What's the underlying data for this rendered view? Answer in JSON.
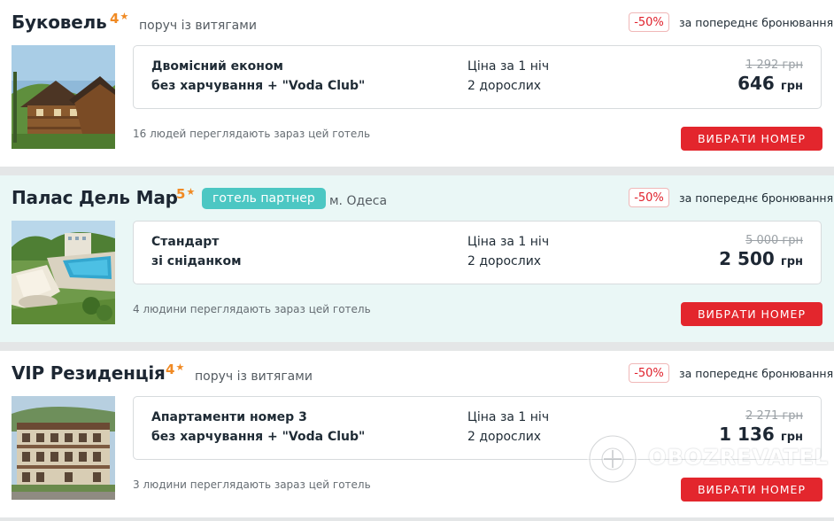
{
  "hotels": [
    {
      "name": "Буковель",
      "stars": "4",
      "star_glyph": "★",
      "partner_badge": "",
      "location": "поруч із витягами",
      "discount": "-50%",
      "discount_note": "за попереднє бронювання",
      "room_line1": "Двомісний економ",
      "room_line2": "без харчування + \"Voda Club\"",
      "price_label": "Ціна за 1 ніч",
      "guests": "2 дорослих",
      "old_price": "1 292 грн",
      "new_price": "646",
      "currency": "грн",
      "viewers": "16 людей переглядають зараз цей готель",
      "button": "ВИБРАТИ НОМЕР"
    },
    {
      "name": "Палас Дель Мар",
      "stars": "5",
      "star_glyph": "★",
      "partner_badge": "готель партнер",
      "location": "м. Одеса",
      "discount": "-50%",
      "discount_note": "за попереднє бронювання",
      "room_line1": "Стандарт",
      "room_line2": "зі сніданком",
      "price_label": "Ціна за 1 ніч",
      "guests": "2 дорослих",
      "old_price": "5 000 грн",
      "new_price": "2 500",
      "currency": "грн",
      "viewers": "4 людини переглядають зараз цей готель",
      "button": "ВИБРАТИ НОМЕР"
    },
    {
      "name": "VIP Резиденція",
      "stars": "4",
      "star_glyph": "★",
      "partner_badge": "",
      "location": "поруч із витягами",
      "discount": "-50%",
      "discount_note": "за попереднє бронювання",
      "room_line1": "Апартаменти номер 3",
      "room_line2": "без харчування + \"Voda Club\"",
      "price_label": "Ціна за 1 ніч",
      "guests": "2 дорослих",
      "old_price": "2 271 грн",
      "new_price": "1 136",
      "currency": "грн",
      "viewers": "3 людини переглядають зараз цей готель",
      "button": "ВИБРАТИ НОМЕР"
    }
  ],
  "watermark": "OBOZREVATEL",
  "colors": {
    "accent_red": "#e3262d",
    "star_orange": "#f08a24",
    "partner_teal": "#4cc7c3",
    "partner_bg": "#eaf7f6",
    "page_bg": "#e4e6e7"
  },
  "icons": {
    "star": "star-icon",
    "watermark_logo": "obozrevatel-logo-icon"
  }
}
